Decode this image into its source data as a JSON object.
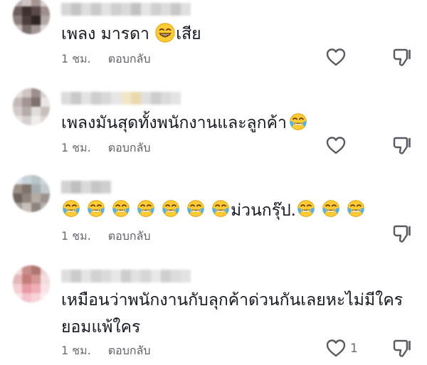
{
  "comments": [
    {
      "text_before": "เพลง มารดา",
      "text_after": "เสีย",
      "time": "1 ชม.",
      "reply_label": "ตอบกลับ",
      "emoji": "grin-emoji"
    },
    {
      "text_before": "เพลงมันสุดทั้งพนักงานและลูกค้า",
      "time": "1 ชม.",
      "reply_label": "ตอบกลับ",
      "emoji": "tears-of-joy-emoji"
    },
    {
      "text_middle": "ม่วนกรุ๊ป.",
      "time": "1 ชม.",
      "reply_label": "ตอบกลับ",
      "emoji": "tears-of-joy-emoji"
    },
    {
      "line1": "เหมือนว่าพนักงานกับลุกค้าด่วนกันเลยหะไม่มีใคร",
      "line2": "ยอมแพ้ใคร",
      "time": "1 ชม.",
      "reply_label": "ตอบกลับ",
      "like_count": "1"
    }
  ],
  "icons": {
    "like": "heart-outline-icon",
    "dislike": "thumbs-down-icon"
  },
  "colors": {
    "text": "#161823",
    "meta": "#6b6b73",
    "emoji_face": "#ffcc33",
    "emoji_tear": "#4fb3f0"
  }
}
